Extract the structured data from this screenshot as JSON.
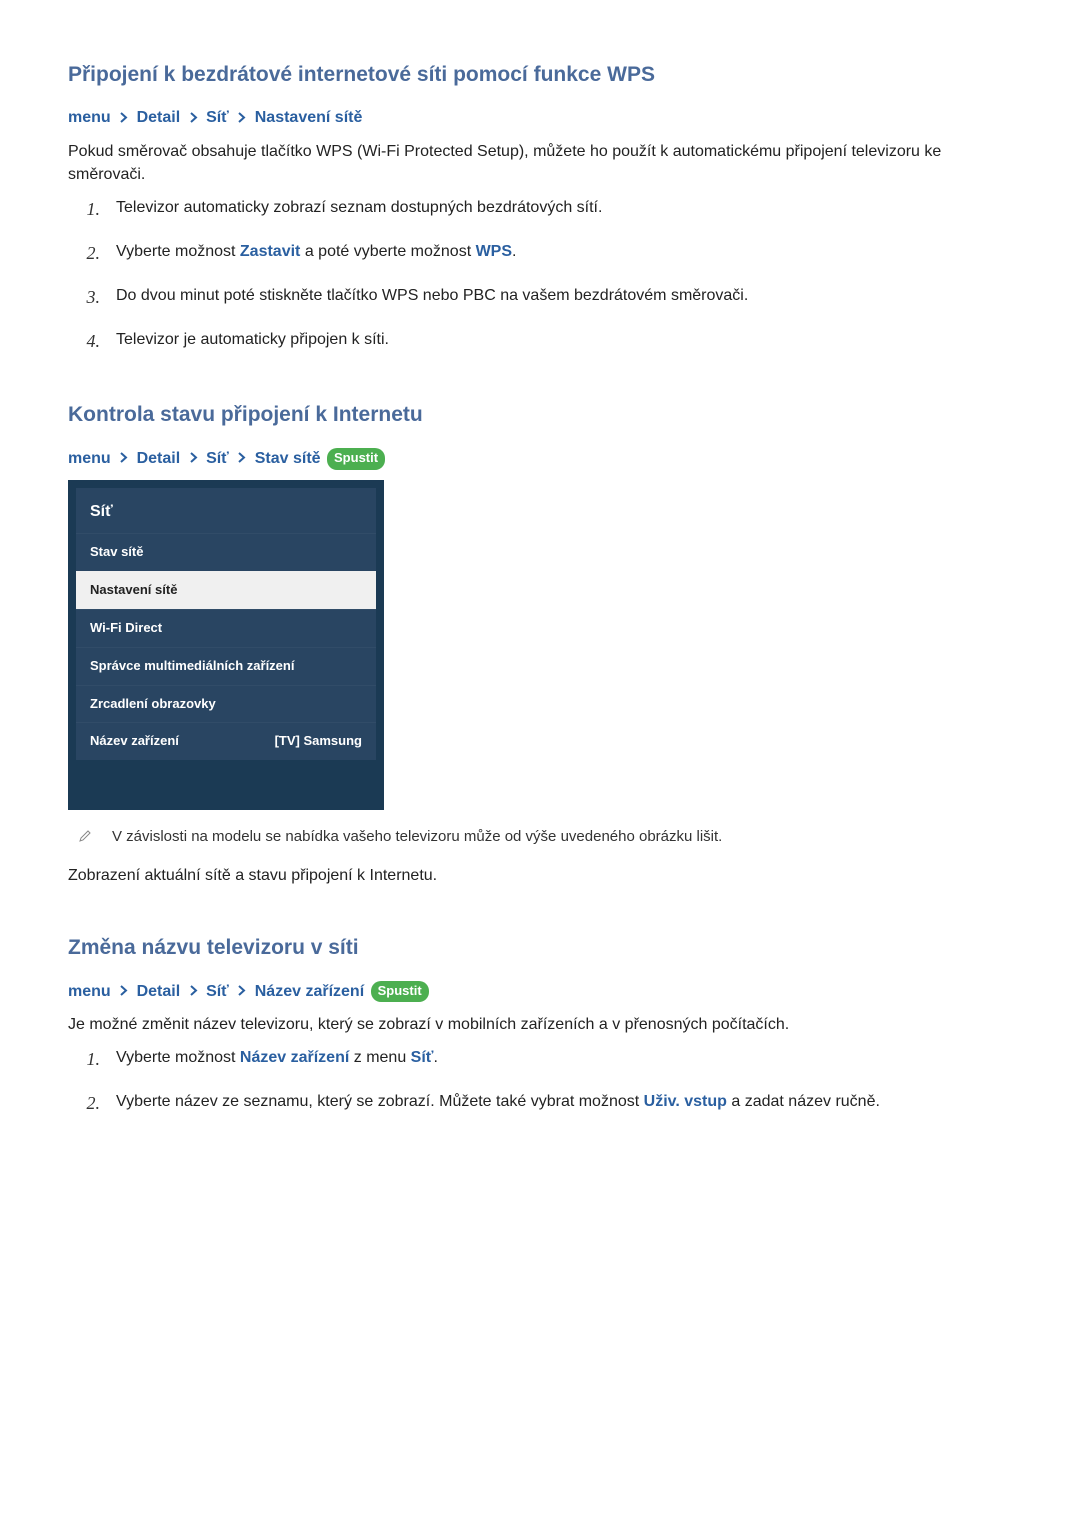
{
  "sections": {
    "wps": {
      "heading": "Připojení k bezdrátové internetové síti pomocí funkce WPS",
      "breadcrumb": [
        "menu",
        "Detail",
        "Síť",
        "Nastavení sítě"
      ],
      "intro": "Pokud směrovač obsahuje tlačítko WPS (Wi-Fi Protected Setup), můžete ho použít k automatickému připojení televizoru ke směrovači.",
      "steps": [
        {
          "n": "1.",
          "pre": "Televizor automaticky zobrazí seznam dostupných bezdrátových sítí."
        },
        {
          "n": "2.",
          "pre": "Vyberte možnost ",
          "kw1": "Zastavit",
          "mid": " a poté vyberte možnost ",
          "kw2": "WPS",
          "post": "."
        },
        {
          "n": "3.",
          "pre": "Do dvou minut poté stiskněte tlačítko WPS nebo PBC na vašem bezdrátovém směrovači."
        },
        {
          "n": "4.",
          "pre": "Televizor je automaticky připojen k síti."
        }
      ]
    },
    "status": {
      "heading": "Kontrola stavu připojení k Internetu",
      "breadcrumb": [
        "menu",
        "Detail",
        "Síť",
        "Stav sítě"
      ],
      "run_label": "Spustit",
      "note": "V závislosti na modelu se nabídka vašeho televizoru může od výše uvedeného obrázku lišit.",
      "body": "Zobrazení aktuální sítě a stavu připojení k Internetu."
    },
    "rename": {
      "heading": "Změna názvu televizoru v síti",
      "breadcrumb": [
        "menu",
        "Detail",
        "Síť",
        "Název zařízení"
      ],
      "run_label": "Spustit",
      "intro": "Je možné změnit název televizoru, který se zobrazí v mobilních zařízeních a v přenosných počítačích.",
      "steps": [
        {
          "n": "1.",
          "pre": "Vyberte možnost ",
          "kw1": "Název zařízení",
          "mid": " z menu ",
          "kw2": "Síť",
          "post": "."
        },
        {
          "n": "2.",
          "pre": "Vyberte název ze seznamu, který se zobrazí. Můžete také vybrat možnost ",
          "kw1": "Uživ. vstup",
          "post": " a zadat název ručně."
        }
      ]
    }
  },
  "tv_menu": {
    "title": "Síť",
    "items": [
      {
        "label": "Stav sítě"
      },
      {
        "label": "Nastavení sítě",
        "selected": true
      },
      {
        "label": "Wi-Fi Direct"
      },
      {
        "label": "Správce multimediálních zařízení"
      },
      {
        "label": "Zrcadlení obrazovky"
      },
      {
        "label": "Název zařízení",
        "value": "[TV] Samsung"
      }
    ]
  }
}
